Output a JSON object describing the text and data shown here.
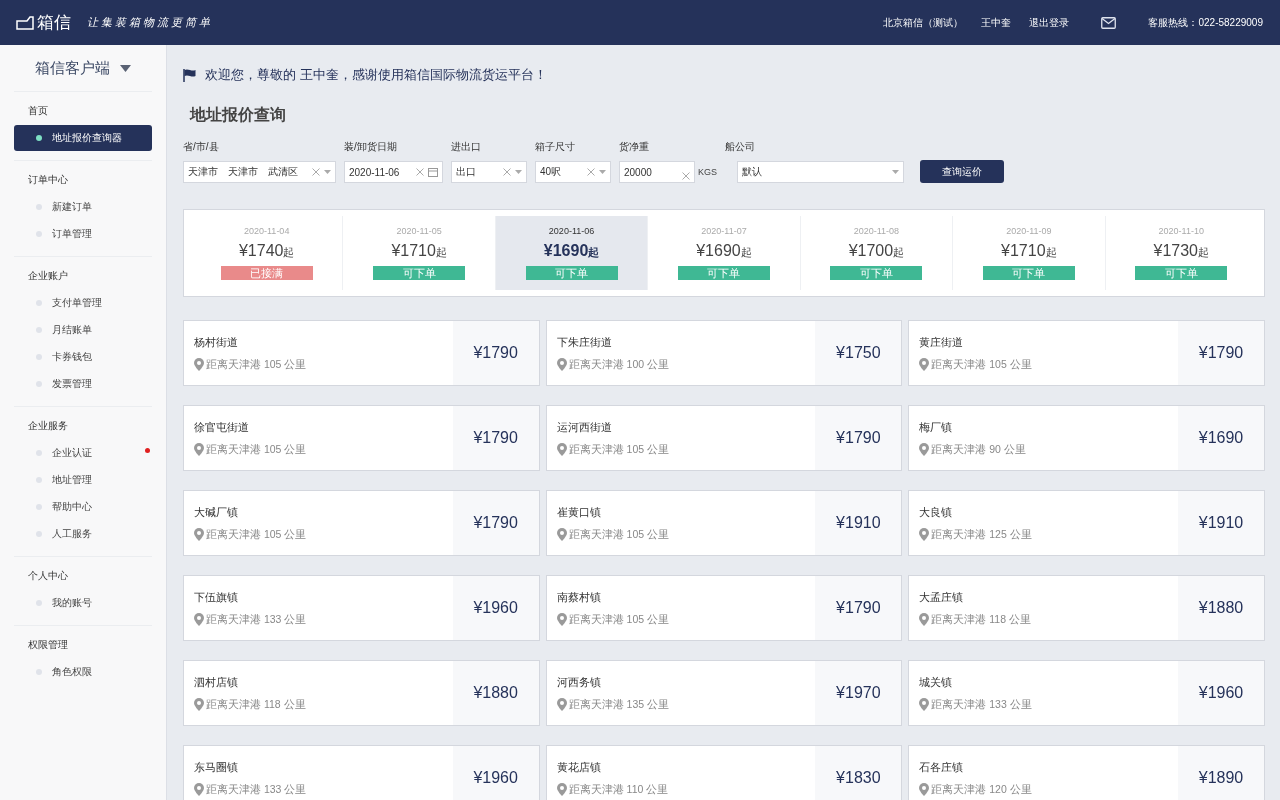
{
  "header": {
    "logo": "箱信",
    "slogan": "让集装箱物流更简单",
    "company": "北京箱信（测试）",
    "user": "王中奎",
    "logout": "退出登录",
    "hotline": "客服热线：022-58229009"
  },
  "sidebar": {
    "title": "箱信客户端",
    "groups": [
      {
        "title": "首页",
        "items": [
          {
            "label": "地址报价查询器",
            "selected": true,
            "badge": false
          }
        ]
      },
      {
        "title": "订单中心",
        "items": [
          {
            "label": "新建订单",
            "selected": false,
            "badge": false
          },
          {
            "label": "订单管理",
            "selected": false,
            "badge": false
          }
        ]
      },
      {
        "title": "企业账户",
        "items": [
          {
            "label": "支付单管理",
            "selected": false,
            "badge": false
          },
          {
            "label": "月结账单",
            "selected": false,
            "badge": false
          },
          {
            "label": "卡券钱包",
            "selected": false,
            "badge": false
          },
          {
            "label": "发票管理",
            "selected": false,
            "badge": false
          }
        ]
      },
      {
        "title": "企业服务",
        "items": [
          {
            "label": "企业认证",
            "selected": false,
            "badge": true
          },
          {
            "label": "地址管理",
            "selected": false,
            "badge": false
          },
          {
            "label": "帮助中心",
            "selected": false,
            "badge": false
          },
          {
            "label": "人工服务",
            "selected": false,
            "badge": false
          }
        ]
      },
      {
        "title": "个人中心",
        "items": [
          {
            "label": "我的账号",
            "selected": false,
            "badge": false
          }
        ]
      },
      {
        "title": "权限管理",
        "items": [
          {
            "label": "角色权限",
            "selected": false,
            "badge": false
          }
        ]
      }
    ]
  },
  "welcome": "欢迎您，尊敬的 王中奎，感谢使用箱信国际物流货运平台！",
  "page_title": "地址报价查询",
  "filters": [
    {
      "kind": "region",
      "label": "省/市/县",
      "parts": [
        "天津市",
        "天津市",
        "武清区"
      ]
    },
    {
      "kind": "date",
      "label": "装/卸货日期",
      "value": "2020-11-06"
    },
    {
      "kind": "select",
      "label": "进出口",
      "value": "出口"
    },
    {
      "kind": "select",
      "label": "箱子尺寸",
      "value": "40呎"
    },
    {
      "kind": "weight",
      "label": "货净重",
      "value": "20000",
      "unit": "KGS"
    },
    {
      "kind": "dropdown",
      "label": "船公司",
      "value": "默认"
    }
  ],
  "query_button": "查询运价",
  "dates": [
    {
      "date": "2020-11-04",
      "price": "¥1740",
      "suffix": "起",
      "status": "已接满",
      "available": false,
      "selected": false
    },
    {
      "date": "2020-11-05",
      "price": "¥1710",
      "suffix": "起",
      "status": "可下单",
      "available": true,
      "selected": false
    },
    {
      "date": "2020-11-06",
      "price": "¥1690",
      "suffix": "起",
      "status": "可下单",
      "available": true,
      "selected": true
    },
    {
      "date": "2020-11-07",
      "price": "¥1690",
      "suffix": "起",
      "status": "可下单",
      "available": true,
      "selected": false
    },
    {
      "date": "2020-11-08",
      "price": "¥1700",
      "suffix": "起",
      "status": "可下单",
      "available": true,
      "selected": false
    },
    {
      "date": "2020-11-09",
      "price": "¥1710",
      "suffix": "起",
      "status": "可下单",
      "available": true,
      "selected": false
    },
    {
      "date": "2020-11-10",
      "price": "¥1730",
      "suffix": "起",
      "status": "可下单",
      "available": true,
      "selected": false
    }
  ],
  "addresses": [
    {
      "name": "杨村街道",
      "distance": "距离天津港 105 公里",
      "price": "¥1790"
    },
    {
      "name": "下朱庄街道",
      "distance": "距离天津港 100 公里",
      "price": "¥1750"
    },
    {
      "name": "黄庄街道",
      "distance": "距离天津港 105 公里",
      "price": "¥1790"
    },
    {
      "name": "徐官屯街道",
      "distance": "距离天津港 105 公里",
      "price": "¥1790"
    },
    {
      "name": "运河西街道",
      "distance": "距离天津港 105 公里",
      "price": "¥1790"
    },
    {
      "name": "梅厂镇",
      "distance": "距离天津港 90 公里",
      "price": "¥1690"
    },
    {
      "name": "大碱厂镇",
      "distance": "距离天津港 105 公里",
      "price": "¥1790"
    },
    {
      "name": "崔黄口镇",
      "distance": "距离天津港 105 公里",
      "price": "¥1910"
    },
    {
      "name": "大良镇",
      "distance": "距离天津港 125 公里",
      "price": "¥1910"
    },
    {
      "name": "下伍旗镇",
      "distance": "距离天津港 133 公里",
      "price": "¥1960"
    },
    {
      "name": "南蔡村镇",
      "distance": "距离天津港 105 公里",
      "price": "¥1790"
    },
    {
      "name": "大孟庄镇",
      "distance": "距离天津港 118 公里",
      "price": "¥1880"
    },
    {
      "name": "泗村店镇",
      "distance": "距离天津港 118 公里",
      "price": "¥1880"
    },
    {
      "name": "河西务镇",
      "distance": "距离天津港 135 公里",
      "price": "¥1970"
    },
    {
      "name": "城关镇",
      "distance": "距离天津港 133 公里",
      "price": "¥1960"
    },
    {
      "name": "东马圈镇",
      "distance": "距离天津港 133 公里",
      "price": "¥1960"
    },
    {
      "name": "黄花店镇",
      "distance": "距离天津港 110 公里",
      "price": "¥1830"
    },
    {
      "name": "石各庄镇",
      "distance": "距离天津港 120 公里",
      "price": "¥1890"
    }
  ]
}
